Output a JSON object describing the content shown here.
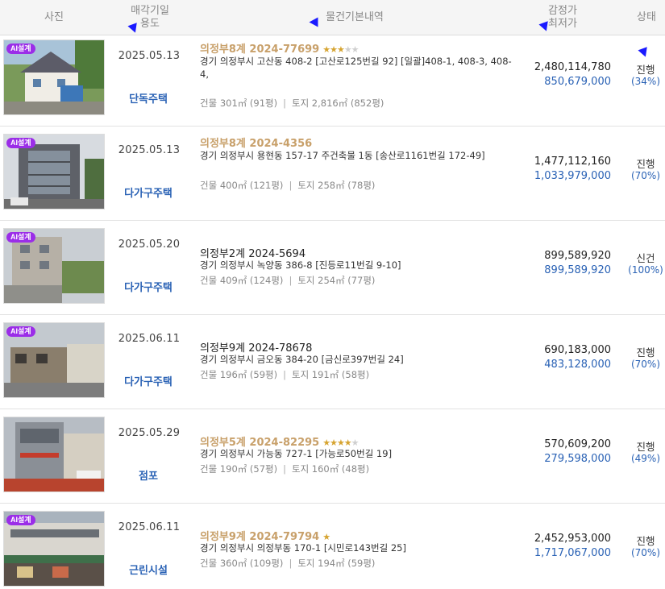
{
  "header": {
    "photo": "사진",
    "date_line1": "매각기일",
    "date_line2": "용도",
    "info": "물건기본내역",
    "price_line1": "감정가",
    "price_line2": "최저가",
    "status": "상태"
  },
  "rows": [
    {
      "ai_badge": "AI설계",
      "date": "2025.05.13",
      "usage": "단독주택",
      "case": "의정부8계 2024-77699",
      "stars_on": "★★★",
      "stars_off": "★★",
      "address": "경기 의정부시 고산동 408-2 [고산로125번길 92] [일괄]408-1, 408-3, 408-4,",
      "building": "건물 301㎡ (91평)",
      "land": "토지 2,816㎡ (852평)",
      "appraisal": "2,480,114,780",
      "min_price": "850,679,000",
      "status": "진행",
      "ratio": "(34%)"
    },
    {
      "ai_badge": "AI설계",
      "date": "2025.05.13",
      "usage": "다가구주택",
      "case": "의정부8계 2024-4356",
      "stars_on": "",
      "stars_off": "",
      "address": "경기 의정부시 용현동 157-17 주건축물 1동 [송산로1161번길 172-49]",
      "building": "건물 400㎡ (121평)",
      "land": "토지 258㎡ (78평)",
      "appraisal": "1,477,112,160",
      "min_price": "1,033,979,000",
      "status": "진행",
      "ratio": "(70%)"
    },
    {
      "ai_badge": "AI설계",
      "date": "2025.05.20",
      "usage": "다가구주택",
      "case": "의정부2계 2024-5694",
      "stars_on": "",
      "stars_off": "",
      "address": "경기 의정부시 녹양동 386-8 [진등로11번길 9-10]",
      "building": "건물 409㎡ (124평)",
      "land": "토지 254㎡ (77평)",
      "appraisal": "899,589,920",
      "min_price": "899,589,920",
      "status": "신건",
      "ratio": "(100%)"
    },
    {
      "ai_badge": "AI설계",
      "date": "2025.06.11",
      "usage": "다가구주택",
      "case": "의정부9계 2024-78678",
      "stars_on": "",
      "stars_off": "",
      "address": "경기 의정부시 금오동 384-20 [금신로397번길 24]",
      "building": "건물 196㎡ (59평)",
      "land": "토지 191㎡ (58평)",
      "appraisal": "690,183,000",
      "min_price": "483,128,000",
      "status": "진행",
      "ratio": "(70%)"
    },
    {
      "ai_badge": "",
      "date": "2025.05.29",
      "usage": "점포",
      "case": "의정부5계 2024-82295",
      "stars_on": "★★★★",
      "stars_off": "★",
      "address": "경기 의정부시 가능동 727-1 [가능로50번길 19]",
      "building": "건물 190㎡ (57평)",
      "land": "토지 160㎡ (48평)",
      "appraisal": "570,609,200",
      "min_price": "279,598,000",
      "status": "진행",
      "ratio": "(49%)"
    },
    {
      "ai_badge": "AI설계",
      "date": "2025.06.11",
      "usage": "근린시설",
      "case": "의정부9계 2024-79794",
      "stars_on": "★",
      "stars_off": "",
      "address": "경기 의정부시 의정부동 170-1 [시민로143번길 25]",
      "building": "건물 360㎡ (109평)",
      "land": "토지 194㎡ (59평)",
      "appraisal": "2,452,953,000",
      "min_price": "1,717,067,000",
      "status": "진행",
      "ratio": "(70%)"
    }
  ],
  "colors": {
    "case_gold": "#c8a06a",
    "usage_blue": "#2a62b5",
    "ai_badge": "#9b2de8"
  }
}
